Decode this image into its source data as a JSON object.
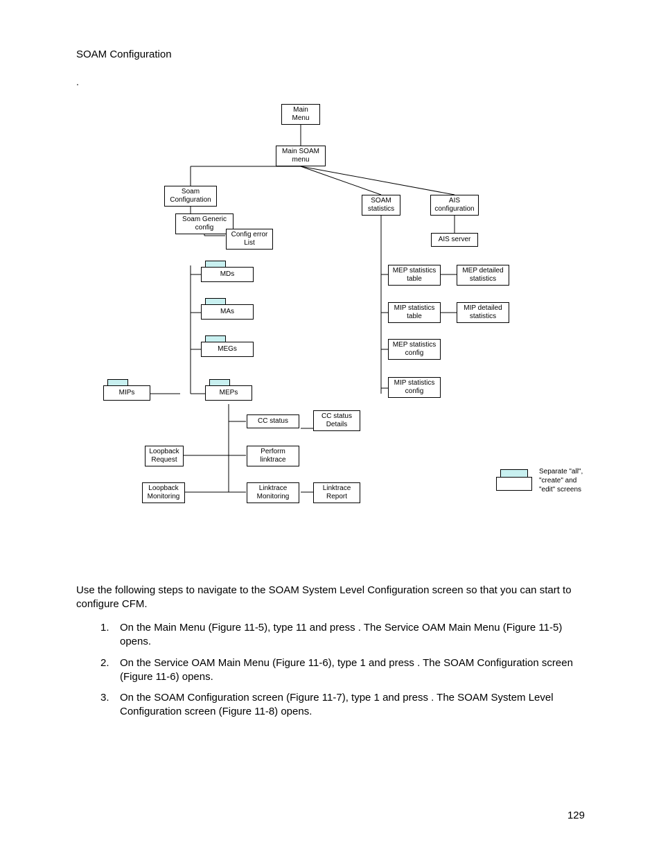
{
  "header": {
    "section": "SOAM Configuration",
    "dot": "."
  },
  "nodes": {
    "main_menu": "Main\nMenu",
    "main_soam_menu": "Main SOAM\nmenu",
    "soam_configuration": "Soam\nConfiguration",
    "soam_statistics": "SOAM\nstatistics",
    "ais_configuration": "AIS\nconfiguration",
    "soam_generic_config": "Soam Generic\nconfig",
    "config_error_list": "Config error\nList",
    "ais_server": "AIS server",
    "mds": "MDs",
    "mep_statistics_table": "MEP statistics\ntable",
    "mep_detailed_statistics": "MEP detailed\nstatistics",
    "mas": "MAs",
    "mip_statistics_table": "MIP statistics\ntable",
    "mip_detailed_statistics": "MIP detailed\nstatistics",
    "megs": "MEGs",
    "mep_statistics_config": "MEP statistics\nconfig",
    "mips": "MIPs",
    "meps": "MEPs",
    "mip_statistics_config": "MIP statistics\nconfig",
    "cc_status": "CC status",
    "cc_status_details": "CC status\nDetails",
    "loopback_request": "Loopback\nRequest",
    "perform_linktrace": "Perform\nlinktrace",
    "loopback_monitoring": "Loopback\nMonitoring",
    "linktrace_monitoring": "Linktrace\nMonitoring",
    "linktrace_report": "Linktrace\nReport"
  },
  "legend": "Separate \"all\",\n\"create\" and\n\"edit\" screens",
  "paragraph": "Use the following steps to navigate to the SOAM System Level Configuration screen so that you can start to configure CFM.",
  "steps": {
    "s1": {
      "n": "1.",
      "t": "On the Main Menu (Figure 11-5), type 11 and press       . The Service OAM Main Menu (Figure 11-5) opens."
    },
    "s2": {
      "n": "2.",
      "t": "On the Service OAM Main Menu (Figure 11-6), type 1 and press       . The SOAM Configuration screen (Figure 11-6) opens."
    },
    "s3": {
      "n": "3.",
      "t": "On the SOAM Configuration screen (Figure 11-7), type 1 and press       . The SOAM System Level Configuration screen (Figure 11-8) opens."
    }
  },
  "page_number": "129"
}
